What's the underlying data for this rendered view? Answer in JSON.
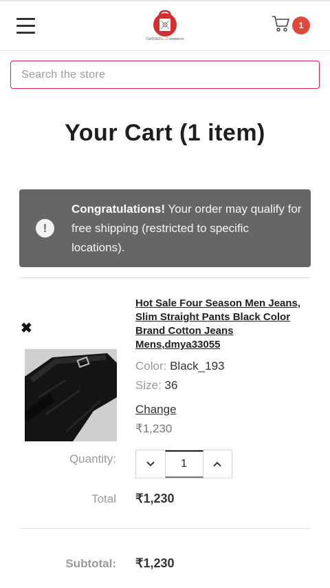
{
  "header": {
    "logo_text": "GetEffiZo...Commerce",
    "cart_count": "1"
  },
  "search": {
    "placeholder": "Search the store"
  },
  "page": {
    "title": "Your Cart (1 item)"
  },
  "notice": {
    "bold": "Congratulations!",
    "text": " Your order may qualify for free shipping (restricted to specific locations)."
  },
  "item": {
    "title": "Hot Sale Four Season Men Jeans, Slim Straight Pants Black Color Brand Cotton Jeans Mens,dmya33055",
    "color_label": "Color:",
    "color_value": "Black_193",
    "size_label": "Size:",
    "size_value": "36",
    "change_label": "Change",
    "unit_price": "₹1,230",
    "quantity_label": "Quantity:",
    "quantity": "1",
    "total_label": "Total",
    "total": "₹1,230"
  },
  "summary": {
    "subtotal_label": "Subtotal:",
    "subtotal": "₹1,230"
  },
  "colors": {
    "accent": "#d8224f",
    "badge": "#e2473b",
    "notice_bg": "#666666"
  }
}
